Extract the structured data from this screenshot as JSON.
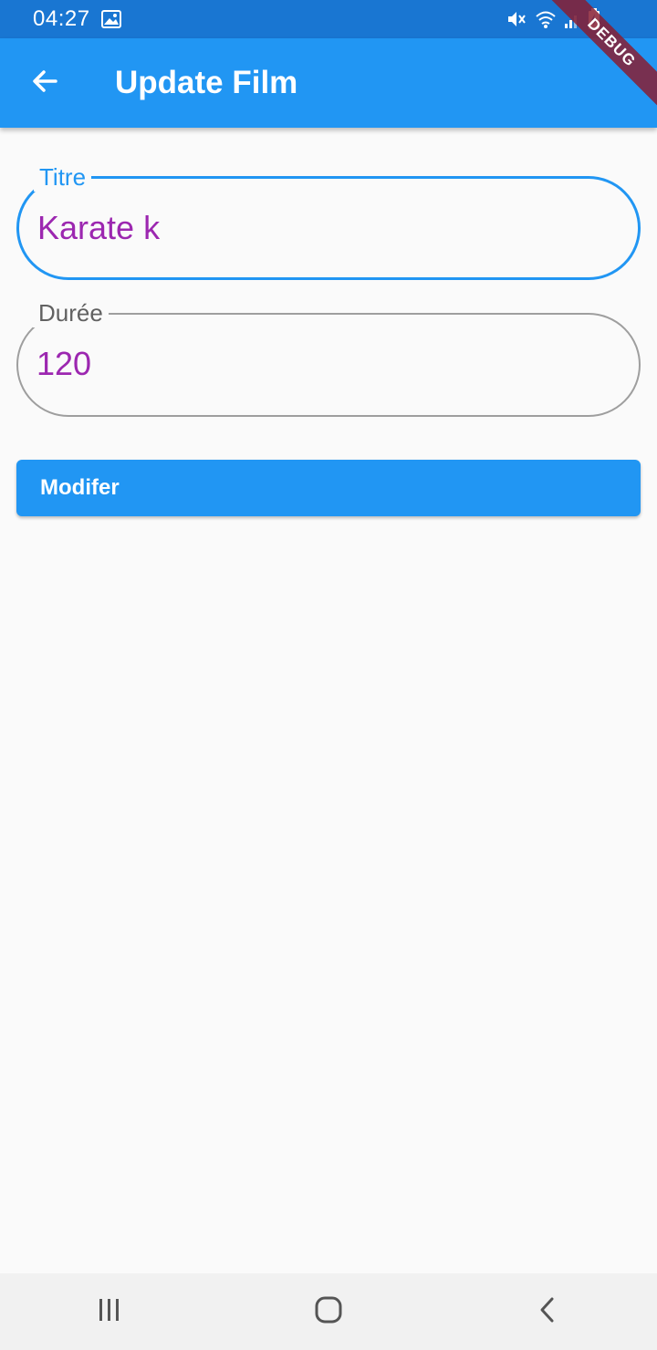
{
  "status_bar": {
    "time": "04:27",
    "icons": [
      "image-icon",
      "mute-icon",
      "wifi-icon",
      "signal-icon",
      "battery-charging-icon"
    ]
  },
  "debug_banner": "DEBUG",
  "app_bar": {
    "title": "Update Film",
    "back_icon": "arrow-back-icon"
  },
  "form": {
    "titre": {
      "label": "Titre",
      "value": "Karate k",
      "focused": true
    },
    "duree": {
      "label": "Durée",
      "value": "120",
      "focused": false
    },
    "submit_label": "Modifer"
  },
  "nav_bar": {
    "icons": [
      "recent-apps-icon",
      "home-icon",
      "back-icon"
    ]
  },
  "colors": {
    "status_bar": "#1976d2",
    "app_bar": "#2196f3",
    "accent": "#2196f3",
    "input_text": "#9c27b0",
    "background": "#fafafa"
  }
}
